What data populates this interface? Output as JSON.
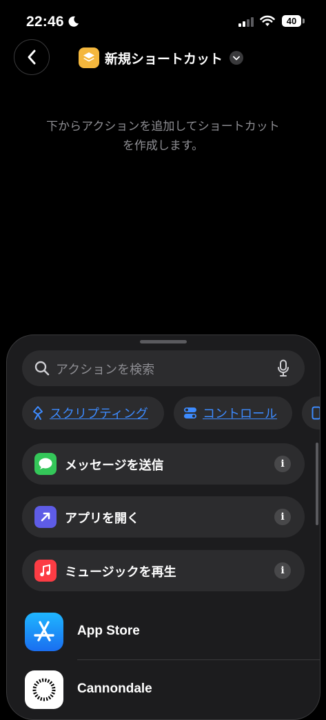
{
  "status_bar": {
    "time": "22:46",
    "battery": "40"
  },
  "header": {
    "title": "新規ショートカット"
  },
  "hint": {
    "line1": "下からアクションを追加してショートカット",
    "line2": "を作成します。"
  },
  "sheet": {
    "search_placeholder": "アクションを検索",
    "chips": [
      {
        "label": "スクリプティング",
        "icon": "scripting-icon"
      },
      {
        "label": "コントロール",
        "icon": "toggle-icon"
      }
    ],
    "actions": [
      {
        "label": "メッセージを送信",
        "icon": "messages-icon",
        "color": "#34c759"
      },
      {
        "label": "アプリを開く",
        "icon": "open-app-arrow-icon",
        "color": "#5e5ce6"
      },
      {
        "label": "ミュージックを再生",
        "icon": "music-note-icon",
        "color": "#fc3c44"
      }
    ],
    "apps": [
      {
        "name": "App Store",
        "icon": "app-store-icon"
      },
      {
        "name": "Cannondale",
        "icon": "cannondale-icon"
      }
    ]
  },
  "colors": {
    "accent": "#3d8bff",
    "shortcuts_yellow": "#f4b73d",
    "background": "#000000",
    "sheet": "#1c1c1e"
  }
}
